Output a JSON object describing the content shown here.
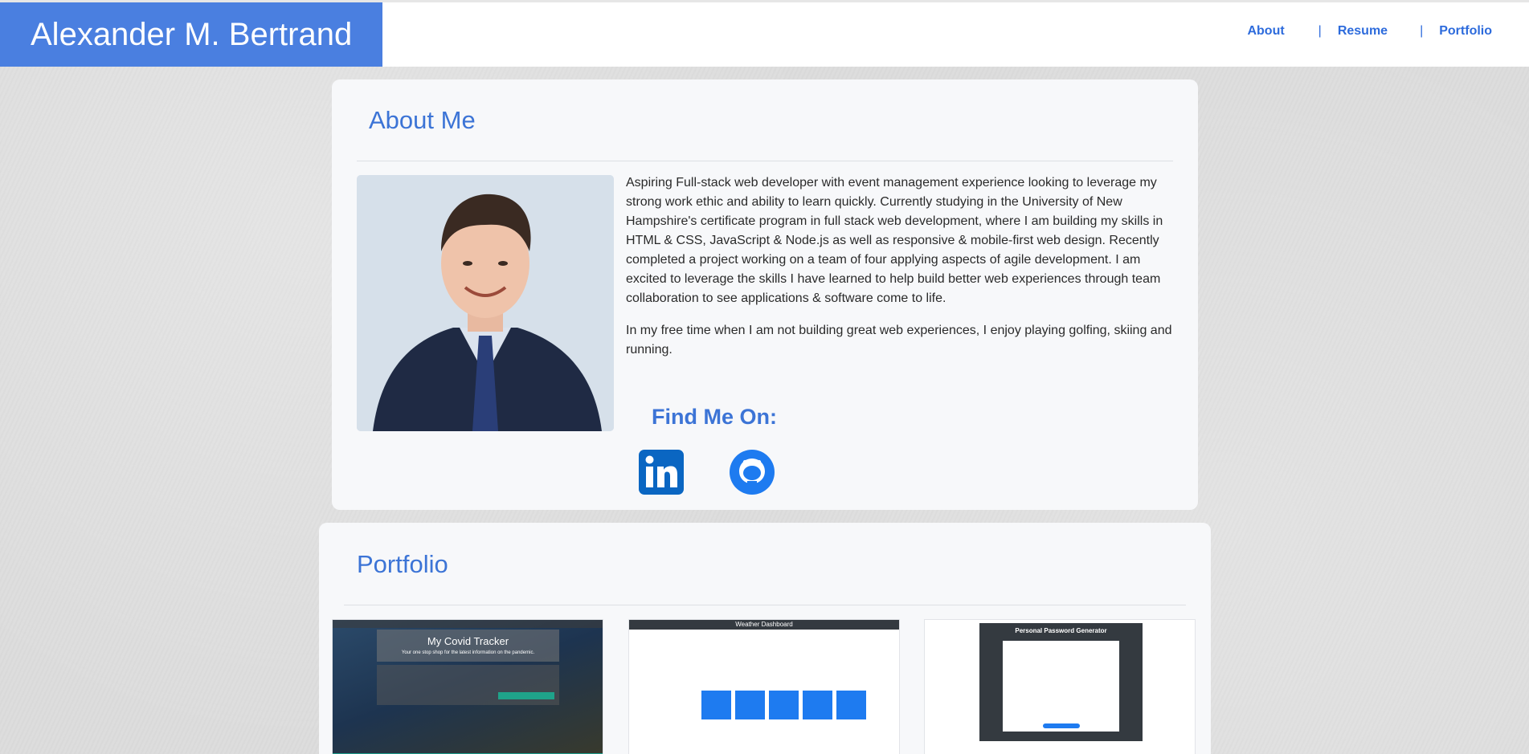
{
  "header": {
    "brand": "Alexander M. Bertrand",
    "nav": [
      {
        "label": "About"
      },
      {
        "label": "Resume"
      },
      {
        "label": "Portfolio"
      }
    ],
    "separator": "|"
  },
  "about": {
    "title": "About Me",
    "paragraphs": [
      "Aspiring Full-stack web developer with event management experience looking to leverage my strong work ethic and ability to learn quickly. Currently studying in the University of New Hampshire's certificate program in full stack web development, where I am building my skills in HTML & CSS, JavaScript & Node.js as well as responsive & mobile-first web design. Recently completed a project working on a team of four applying aspects of agile development. I am excited to leverage the skills I have learned to help build better web experiences through team collaboration to see applications & software come to life.",
      "In my free time when I am not building great web experiences, I enjoy playing golfing, skiing and running."
    ],
    "find_title": "Find Me On:",
    "social": [
      {
        "icon": "linkedin-icon",
        "color": "#0a66c2"
      },
      {
        "icon": "github-icon",
        "color": "#1e7bf0"
      }
    ]
  },
  "portfolio": {
    "title": "Portfolio",
    "projects": [
      {
        "title": "My Covid Tracker",
        "subtitle": "Your one stop shop for the latest information on the pandemic."
      },
      {
        "title": "Weather Dashboard"
      },
      {
        "title": "Personal Password Generator"
      }
    ]
  },
  "colors": {
    "brand": "#4a7fe0",
    "accent": "#3c74d6",
    "nav": "#2d6bdc"
  }
}
